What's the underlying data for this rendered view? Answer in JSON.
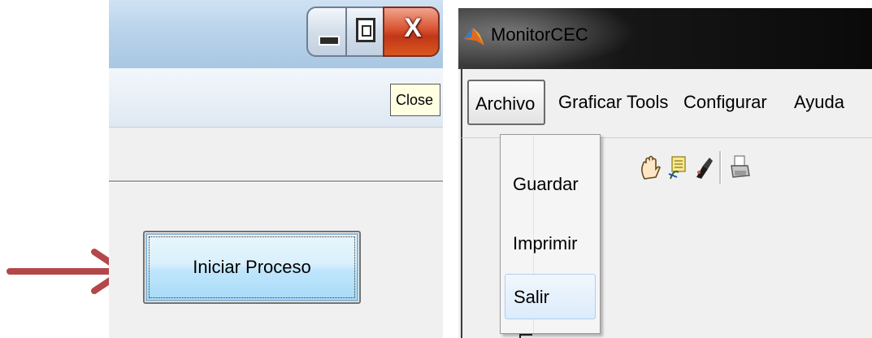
{
  "left_window": {
    "tooltip": "Close",
    "start_button_label": "Iniciar Proceso",
    "close_glyph": "X"
  },
  "right_window": {
    "title": "MonitorCEC",
    "menu": [
      "Archivo",
      "Graficar",
      "Tools",
      "Configurar",
      "Ayuda"
    ],
    "archivo_menu_items": [
      "Guardar",
      "Imprimir",
      "Salir"
    ],
    "toolbar_icons": [
      "hand-icon",
      "data-cursor-icon",
      "brush-icon",
      "print-icon"
    ]
  },
  "colors": {
    "arrow": "#b4474a",
    "close_button": "#d0401f",
    "button_blue": "#bee6fd",
    "highlight": "#dcebfb"
  }
}
